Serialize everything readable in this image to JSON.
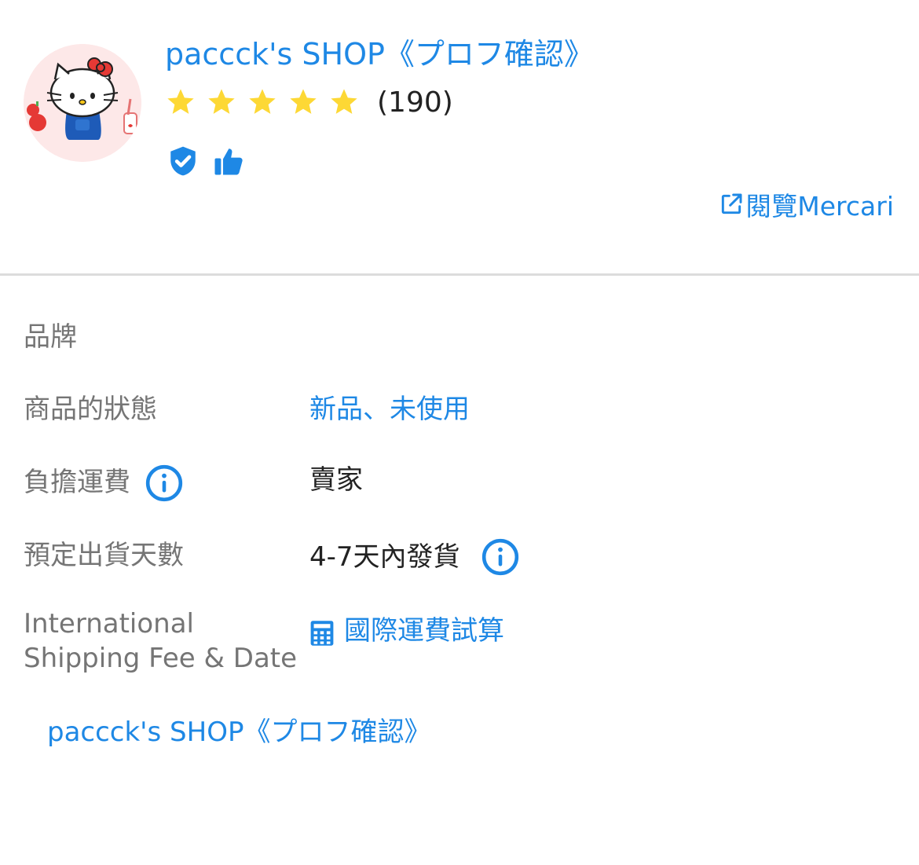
{
  "seller": {
    "name": "paccck's SHOP《プロフ確認》",
    "rating_stars": 5,
    "review_count": "(190)",
    "avatar_icon": "hello-kitty-avatar",
    "badges": [
      "verified-shield-icon",
      "thumbs-up-icon"
    ],
    "open_link_label": "閱覽Mercari",
    "colors": {
      "accent": "#1e88e5",
      "star": "#fdd835"
    }
  },
  "details": {
    "brand_label": "品牌",
    "brand_value": "",
    "condition_label": "商品的狀態",
    "condition_value": "新品、未使用",
    "shipping_payer_label": "負擔運費",
    "shipping_payer_value": "賣家",
    "ship_days_label": "預定出貨天數",
    "ship_days_value": "4-7天內發貨",
    "intl_label_line1": "International",
    "intl_label_line2": "Shipping Fee & Date",
    "intl_calc_label": "國際運費試算"
  },
  "footer": {
    "seller_link": "paccck's SHOP《プロフ確認》"
  }
}
